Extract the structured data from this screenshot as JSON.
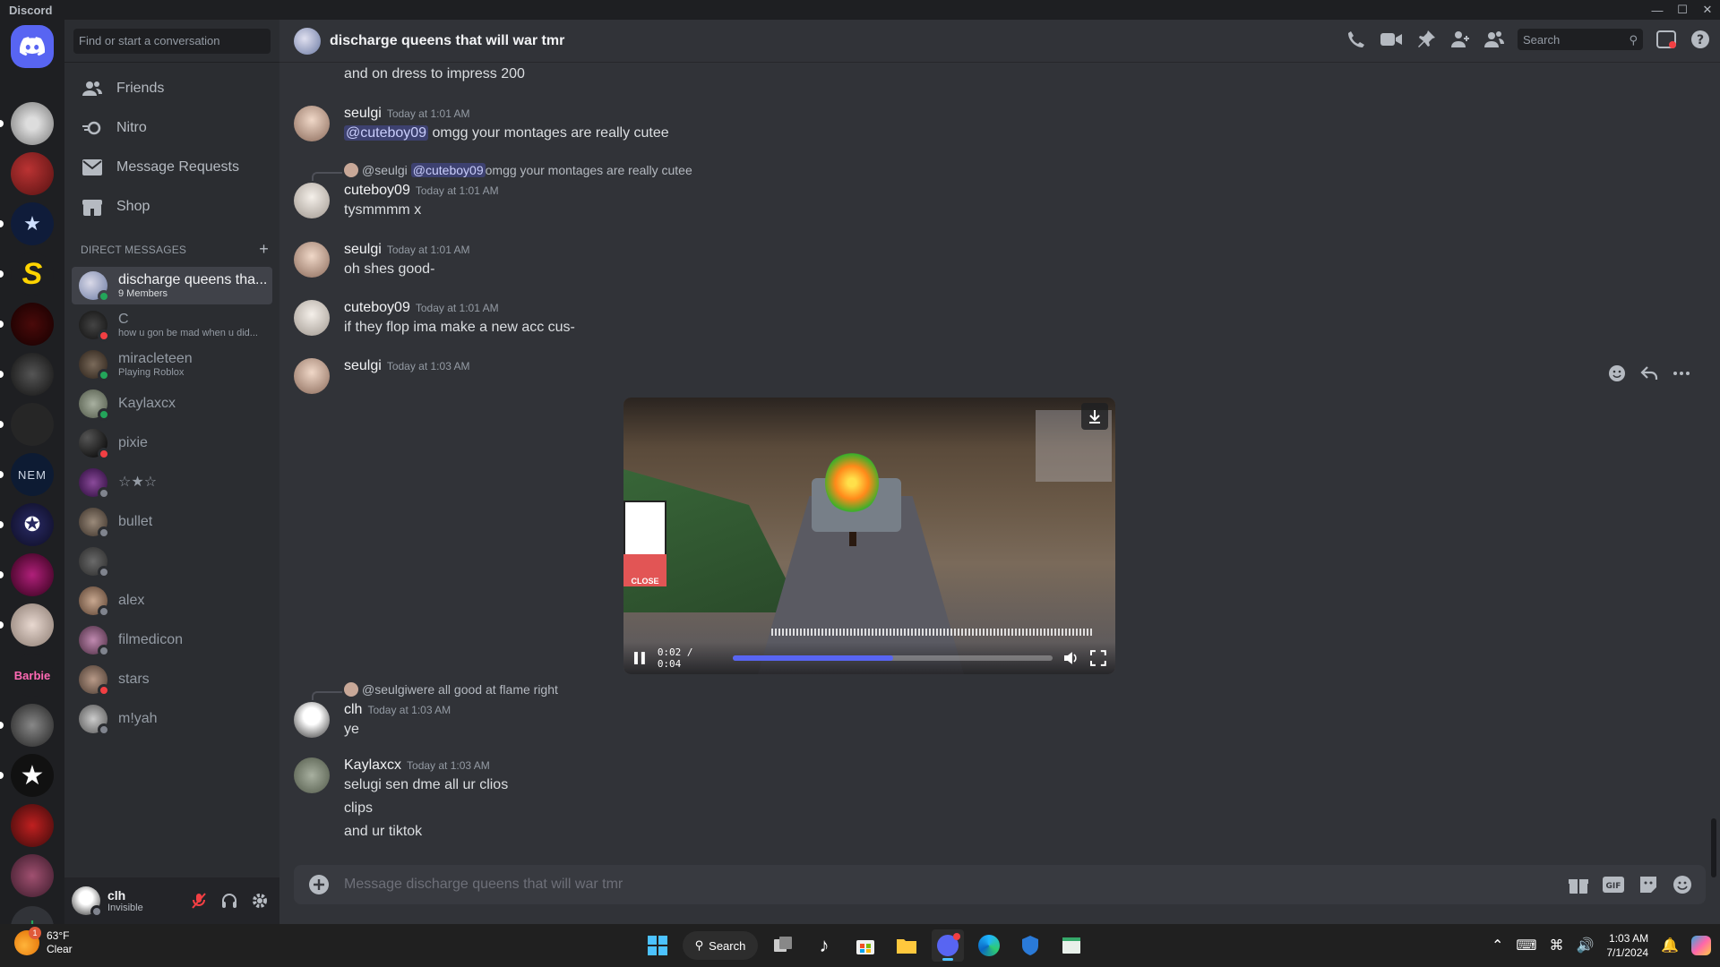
{
  "window": {
    "title": "Discord"
  },
  "dm_sidebar": {
    "search_placeholder": "Find or start a conversation",
    "nav": [
      {
        "label": "Friends",
        "icon": "friends-icon"
      },
      {
        "label": "Nitro",
        "icon": "nitro-icon"
      },
      {
        "label": "Message Requests",
        "icon": "envelope-icon"
      },
      {
        "label": "Shop",
        "icon": "shop-icon"
      }
    ],
    "section_label": "DIRECT MESSAGES",
    "dms": [
      {
        "name": "discharge queens tha...",
        "sub": "9 Members",
        "status": "group",
        "active": true
      },
      {
        "name": "C",
        "sub": "how u gon be mad when u did...",
        "status": "dnd"
      },
      {
        "name": "miracleteen",
        "sub": "Playing Roblox",
        "status": "online"
      },
      {
        "name": "Kaylaxcx",
        "sub": "",
        "status": "online"
      },
      {
        "name": "pixie",
        "sub": "",
        "status": "dnd"
      },
      {
        "name": "☆★☆",
        "sub": "",
        "status": "offline"
      },
      {
        "name": "bullet",
        "sub": "",
        "status": "offline"
      },
      {
        "name": "",
        "sub": "",
        "status": "offline"
      },
      {
        "name": "alex",
        "sub": "",
        "status": "offline"
      },
      {
        "name": "filmedicon",
        "sub": "",
        "status": "offline"
      },
      {
        "name": "stars",
        "sub": "",
        "status": "dnd"
      },
      {
        "name": "m!yah",
        "sub": "",
        "status": "offline"
      }
    ]
  },
  "user_panel": {
    "name": "clh",
    "status": "Invisible"
  },
  "channel": {
    "title": "discharge queens that will war tmr",
    "search_placeholder": "Search"
  },
  "messages": {
    "m0": {
      "text": "and on dress to impress 200"
    },
    "m1": {
      "author": "seulgi",
      "time": "Today at 1:01 AM",
      "mention": "@cuteboy09",
      "text": " omgg your montages are really cutee"
    },
    "m2": {
      "reply_author": "@seulgi",
      "reply_mention": "@cuteboy09",
      "reply_text": " omgg your montages are really cutee",
      "author": "cuteboy09",
      "time": "Today at 1:01 AM",
      "text": "tysmmmm x"
    },
    "m3": {
      "author": "seulgi",
      "time": "Today at 1:01 AM",
      "text": "oh shes good-"
    },
    "m4": {
      "author": "cuteboy09",
      "time": "Today at 1:01 AM",
      "text": "if they flop ima make a new acc cus-"
    },
    "m5": {
      "author": "seulgi",
      "time": "Today at 1:03 AM",
      "video_time": "0:02 / 0:04",
      "progress": 0.5,
      "game_close": "CLOSE"
    },
    "m6": {
      "reply_author": "@seulgi",
      "reply_text": " were all good at flame right",
      "author": "clh",
      "time": "Today at 1:03 AM",
      "text": "ye"
    },
    "m7": {
      "author": "Kaylaxcx",
      "time": "Today at 1:03 AM",
      "lines": [
        "selugi sen dme all ur clios",
        "clips",
        "and ur tiktok"
      ]
    }
  },
  "composer": {
    "placeholder": "Message discharge queens that will war tmr"
  },
  "taskbar": {
    "weather_temp": "63°F",
    "weather_desc": "Clear",
    "weather_badge": "1",
    "search_label": "Search",
    "time": "1:03 AM",
    "date": "7/1/2024"
  },
  "colors": {
    "blurple": "#5865f2",
    "online": "#23a55a",
    "dnd": "#f23f43",
    "offline": "#80848e"
  }
}
